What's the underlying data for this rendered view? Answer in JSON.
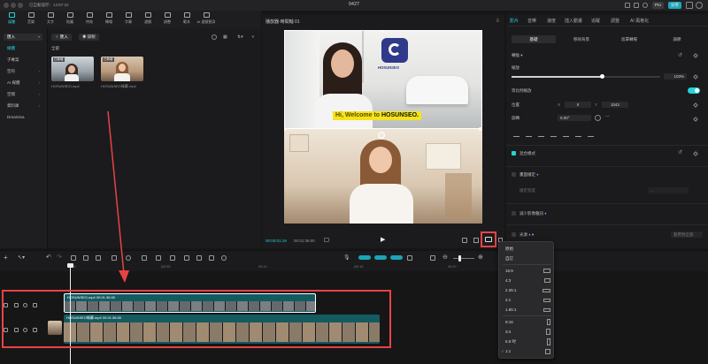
{
  "window": {
    "title": "0427",
    "saved_status": "已自動儲存：14:57:22",
    "pro_label": "Pro",
    "share_label": "分享"
  },
  "toolbar": {
    "items": [
      {
        "label": "媒體",
        "icon": "media-icon"
      },
      {
        "label": "音樂",
        "icon": "music-icon"
      },
      {
        "label": "文字",
        "icon": "text-icon"
      },
      {
        "label": "貼圖",
        "icon": "sticker-icon"
      },
      {
        "label": "特效",
        "icon": "effects-icon"
      },
      {
        "label": "轉場",
        "icon": "transition-icon"
      },
      {
        "label": "字幕",
        "icon": "captions-icon"
      },
      {
        "label": "濾鏡",
        "icon": "filter-icon"
      },
      {
        "label": "調整",
        "icon": "adjust-icon"
      },
      {
        "label": "範本",
        "icon": "template-icon"
      },
      {
        "label": "AI 虛擬替身",
        "icon": "ai-avatar-icon"
      }
    ]
  },
  "media": {
    "sidebar": [
      {
        "label": "匯入",
        "active": true,
        "caret": "▾"
      },
      {
        "label": "媒體",
        "active": false,
        "accent": true
      },
      {
        "label": "子專案",
        "active": false
      },
      {
        "label": "空的",
        "active": false,
        "caret": "›"
      },
      {
        "label": "AI 媒體",
        "active": false,
        "caret": "›"
      },
      {
        "label": "空間",
        "active": false,
        "caret": "›"
      },
      {
        "label": "資料庫",
        "active": false,
        "caret": "›"
      },
      {
        "label": "Dreamina",
        "active": false
      }
    ],
    "import_button": "匯入",
    "record_button": "錄製",
    "all_label": "全部",
    "clips": [
      {
        "name": "HOSUNSEO.mp4",
        "badge": "已新增",
        "duration": "00:01:36"
      },
      {
        "name": "HOSUNSEO綠幕.mp4",
        "badge": "已新增",
        "duration": "00:01:36"
      }
    ]
  },
  "player": {
    "title": "播放器-時間軸 01",
    "caption": "Hi, Welcome to HOSUNSEO.",
    "caption_brand": "HOSUNSEO.",
    "logo_text": "HOSUNSEO",
    "current_time": "00:00:01:19",
    "total_time": "00:01:36:00"
  },
  "inspector": {
    "tabs": [
      "影片",
      "音樂",
      "速度",
      "插入動畫",
      "追蹤",
      "調整",
      "AI 風格化"
    ],
    "subtabs": [
      "基礎",
      "移除背景",
      "遮罩轉場",
      "調節"
    ],
    "transform_label": "轉換",
    "scale_label": "縮放",
    "scale_value": "103%",
    "uniform_scale_label": "等比例縮放",
    "position_label": "位置",
    "position_x_label": "X",
    "position_x": "0",
    "position_y_label": "Y",
    "position_y": "1042",
    "rotation_label": "旋轉",
    "rotation_value": "0.00°",
    "blend_label": "混合模式",
    "stabilize_label": "畫面穩定",
    "stabilize_sub": "穩定程度",
    "stabilize_note": "...",
    "denoise_label": "減少影像雜訊",
    "light_label": "光源",
    "light_button": "套用到全部"
  },
  "timeline": {
    "ruler_ticks": [
      "00:00",
      "|00:05",
      "00:10",
      "|00:15",
      "00:20",
      "|00:25"
    ],
    "track_top_label": "HOSUNSEO.mp4   00:01:36:00",
    "track_bottom_label": "HOSUNSEO綠幕.mp4   00:01:36:00"
  },
  "ratio_menu": {
    "items": [
      {
        "label": "原始",
        "icon": ""
      },
      {
        "label": "自訂",
        "icon": ""
      },
      {
        "label": "16:9",
        "icon": "wide"
      },
      {
        "label": "4:3",
        "icon": "std"
      },
      {
        "label": "2.35:1",
        "icon": "cinema"
      },
      {
        "label": "2:1",
        "icon": "wide2"
      },
      {
        "label": "1.85:1",
        "icon": "wide3"
      },
      {
        "label": "9:16",
        "icon": "tall"
      },
      {
        "label": "3:4",
        "icon": "tall2"
      },
      {
        "label": "5.8 吋",
        "icon": "phone"
      },
      {
        "label": "1:1",
        "icon": "square",
        "checked": true
      }
    ]
  },
  "colors": {
    "accent": "#22d3d8",
    "highlight_red": "#e84343",
    "caption_yellow": "#f5e419"
  }
}
